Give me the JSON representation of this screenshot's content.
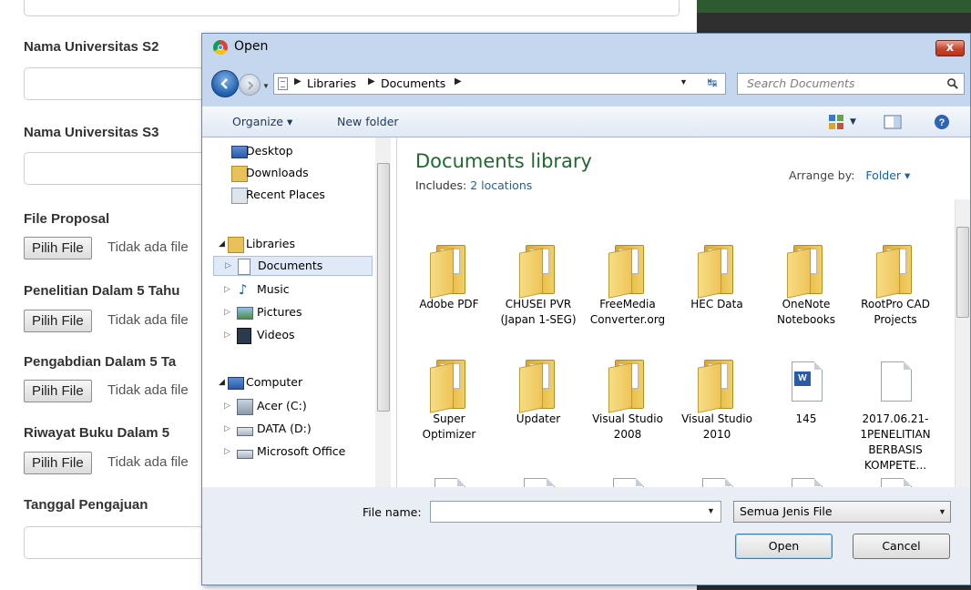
{
  "form": {
    "labels": {
      "s2": "Nama Universitas S2",
      "s3": "Nama Universitas S3",
      "proposal": "File Proposal",
      "penelitian": "Penelitian Dalam 5 Tahu",
      "pengabdian": "Pengabdian Dalam 5 Ta",
      "buku": "Riwayat Buku Dalam 5",
      "tanggal": "Tanggal Pengajuan"
    },
    "file_button_label": "Pilih File",
    "file_status": "Tidak ada file"
  },
  "dialog": {
    "title": "Open",
    "close_label": "x",
    "address": {
      "crumbs": [
        "Libraries",
        "Documents"
      ]
    },
    "search": {
      "placeholder": "Search Documents"
    },
    "toolbar": {
      "organize": "Organize ▾",
      "new_folder": "New folder"
    },
    "nav": {
      "desktop": "Desktop",
      "downloads": "Downloads",
      "recent": "Recent Places",
      "libraries": "Libraries",
      "documents": "Documents",
      "music": "Music",
      "pictures": "Pictures",
      "videos": "Videos",
      "computer": "Computer",
      "acer": "Acer (C:)",
      "data": "DATA (D:)",
      "office": "Microsoft Office"
    },
    "library": {
      "title": "Documents library",
      "includes_label": "Includes:",
      "includes_link": "2 locations",
      "arrange_label": "Arrange by:",
      "arrange_value": "Folder ▾"
    },
    "files": [
      {
        "name": "Adobe PDF",
        "type": "folder"
      },
      {
        "name": "CHUSEI PVR (Japan 1-SEG)",
        "type": "folder"
      },
      {
        "name": "FreeMedia Converter.org",
        "type": "folder"
      },
      {
        "name": "HEC Data",
        "type": "folder"
      },
      {
        "name": "OneNote Notebooks",
        "type": "folder"
      },
      {
        "name": "RootPro CAD Projects",
        "type": "folder"
      },
      {
        "name": "Super Optimizer",
        "type": "folder"
      },
      {
        "name": "Updater",
        "type": "folder"
      },
      {
        "name": "Visual Studio 2008",
        "type": "folder"
      },
      {
        "name": "Visual Studio 2010",
        "type": "folder"
      },
      {
        "name": "145",
        "type": "word"
      },
      {
        "name": "2017.06.21-1PENELITIAN BERBASIS KOMPETE...",
        "type": "blank"
      },
      {
        "name": "",
        "type": "word"
      },
      {
        "name": "",
        "type": "word"
      },
      {
        "name": "",
        "type": "excel"
      },
      {
        "name": "",
        "type": "excel"
      },
      {
        "name": "",
        "type": "word"
      },
      {
        "name": "",
        "type": "word"
      }
    ],
    "bottom": {
      "file_name_label": "File name:",
      "file_name_value": "",
      "filter": "Semua Jenis File",
      "open": "Open",
      "cancel": "Cancel"
    }
  }
}
